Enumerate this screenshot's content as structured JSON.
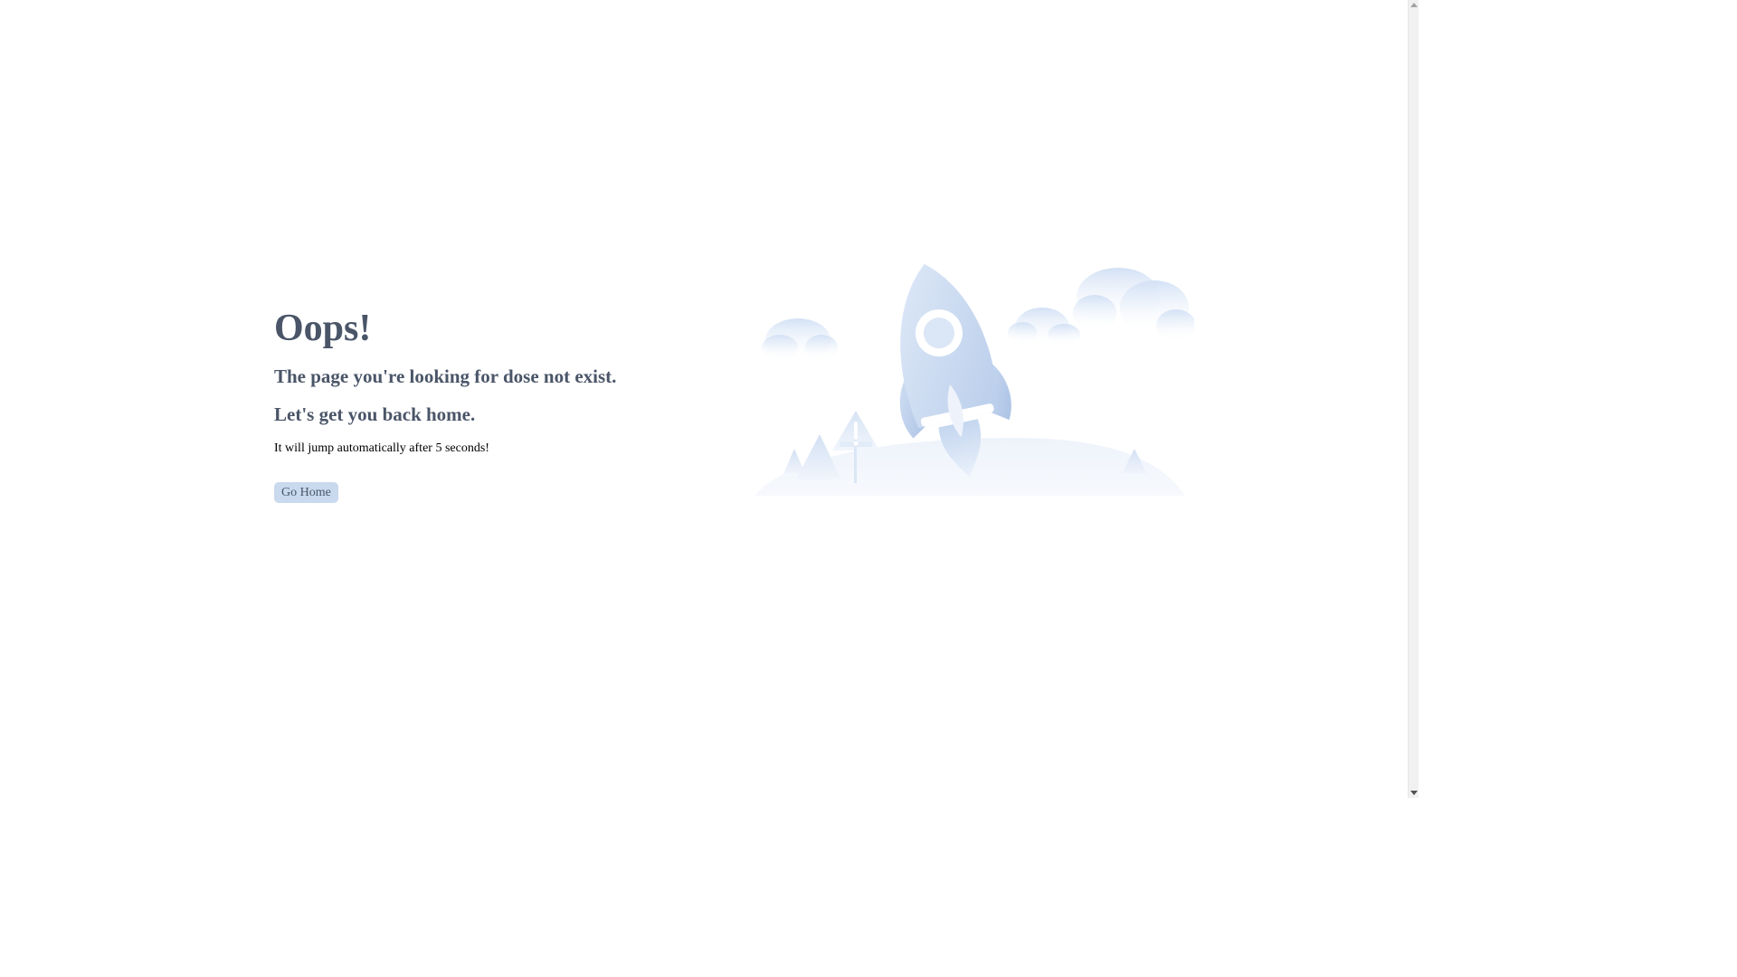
{
  "main": {
    "heading": "Oops!",
    "subtitle_1": "The page you're looking for dose not exist.",
    "subtitle_2": "Let's get you back home.",
    "redirect_text": "It will jump automatically after 5 seconds!",
    "home_button_label": "Go Home"
  },
  "illustration": {
    "icon": "rocket-illustration"
  },
  "colors": {
    "heading_text": "#4a5568",
    "button_background": "#c9d9ee",
    "illustration_blue": "#d6e4f7"
  }
}
